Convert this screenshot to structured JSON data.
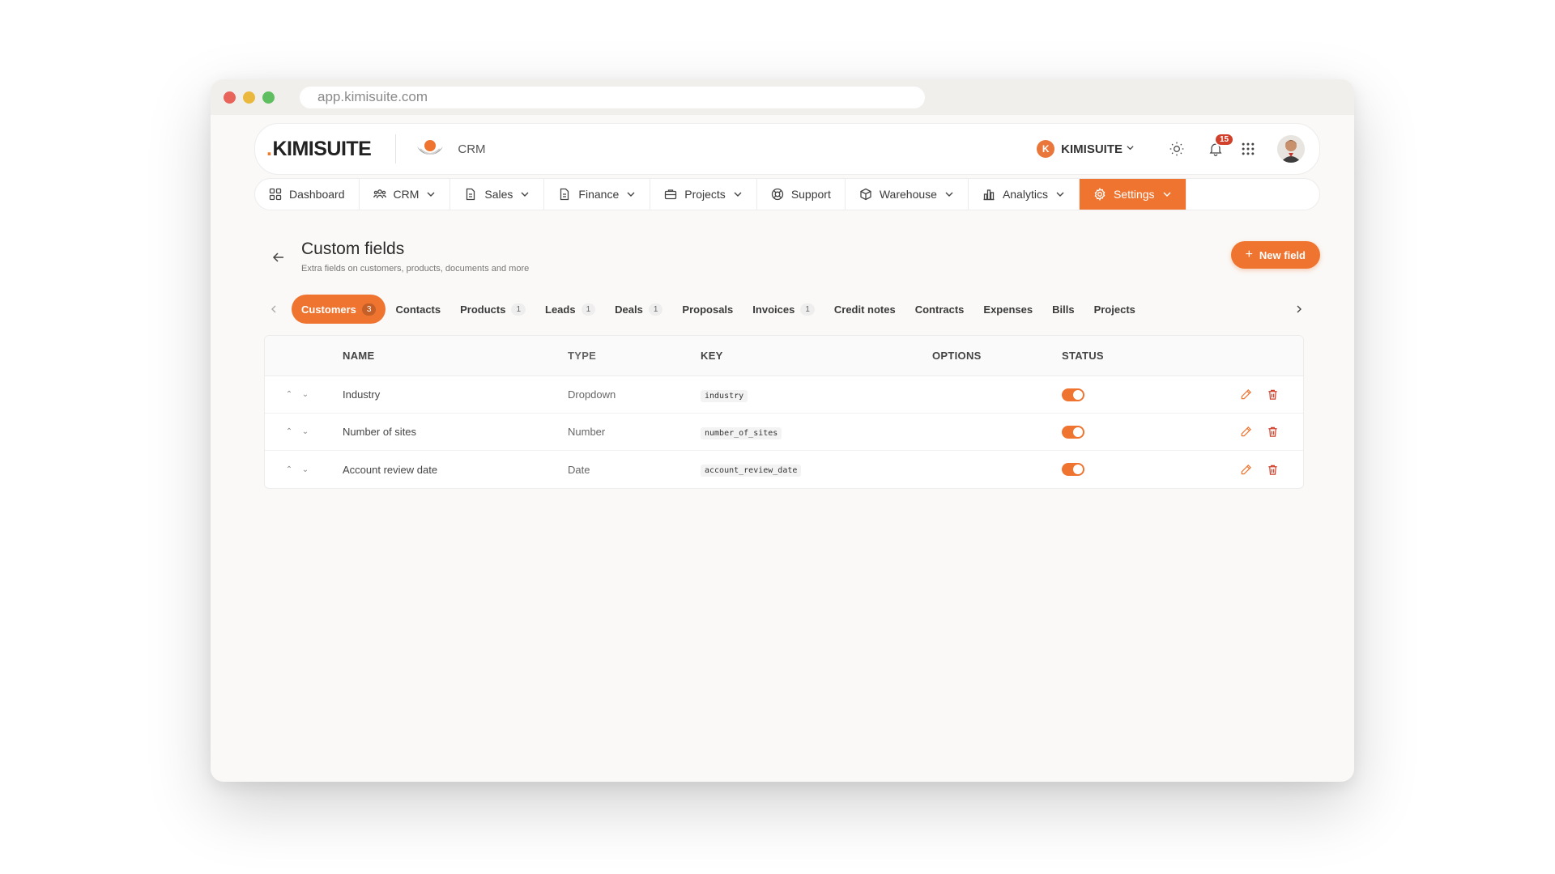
{
  "browser": {
    "url": "app.kimisuite.com"
  },
  "topbar": {
    "brand": "KIMISUITE",
    "brand_prefix": ".",
    "module_label": "CRM",
    "org_initial": "K",
    "org_name": "KIMISUITE",
    "notification_count": "15",
    "icons": [
      "sun-icon",
      "bell-icon",
      "apps-grid-icon",
      "user-avatar"
    ]
  },
  "menu": {
    "items": [
      {
        "label": "Dashboard",
        "icon": "dashboard-icon",
        "has_caret": false
      },
      {
        "label": "CRM",
        "icon": "people-icon",
        "has_caret": true
      },
      {
        "label": "Sales",
        "icon": "document-icon",
        "has_caret": true
      },
      {
        "label": "Finance",
        "icon": "document-icon",
        "has_caret": true
      },
      {
        "label": "Projects",
        "icon": "briefcase-icon",
        "has_caret": true
      },
      {
        "label": "Support",
        "icon": "lifebuoy-icon",
        "has_caret": false
      },
      {
        "label": "Warehouse",
        "icon": "box-icon",
        "has_caret": true
      },
      {
        "label": "Analytics",
        "icon": "bar-chart-icon",
        "has_caret": true
      },
      {
        "label": "Settings",
        "icon": "gear-icon",
        "has_caret": true,
        "active": true
      }
    ]
  },
  "page": {
    "title": "Custom fields",
    "subtitle": "Extra fields on customers, products, documents and more",
    "new_button": "New field"
  },
  "tabs": [
    {
      "label": "Customers",
      "count": "3",
      "active": true
    },
    {
      "label": "Contacts",
      "count": ""
    },
    {
      "label": "Products",
      "count": "1"
    },
    {
      "label": "Leads",
      "count": "1"
    },
    {
      "label": "Deals",
      "count": "1"
    },
    {
      "label": "Proposals",
      "count": ""
    },
    {
      "label": "Invoices",
      "count": "1"
    },
    {
      "label": "Credit notes",
      "count": ""
    },
    {
      "label": "Contracts",
      "count": ""
    },
    {
      "label": "Expenses",
      "count": ""
    },
    {
      "label": "Bills",
      "count": ""
    },
    {
      "label": "Projects",
      "count": ""
    }
  ],
  "table": {
    "headers": {
      "name": "NAME",
      "type": "TYPE",
      "key": "KEY",
      "options": "OPTIONS",
      "status": "STATUS"
    },
    "rows": [
      {
        "name": "Industry",
        "type": "Dropdown",
        "key": "industry",
        "options": "",
        "status_on": true
      },
      {
        "name": "Number of sites",
        "type": "Number",
        "key": "number_of_sites",
        "options": "",
        "status_on": true
      },
      {
        "name": "Account review date",
        "type": "Date",
        "key": "account_review_date",
        "options": "",
        "status_on": true
      }
    ]
  },
  "colors": {
    "accent": "#ef7430",
    "danger": "#d0402b"
  }
}
